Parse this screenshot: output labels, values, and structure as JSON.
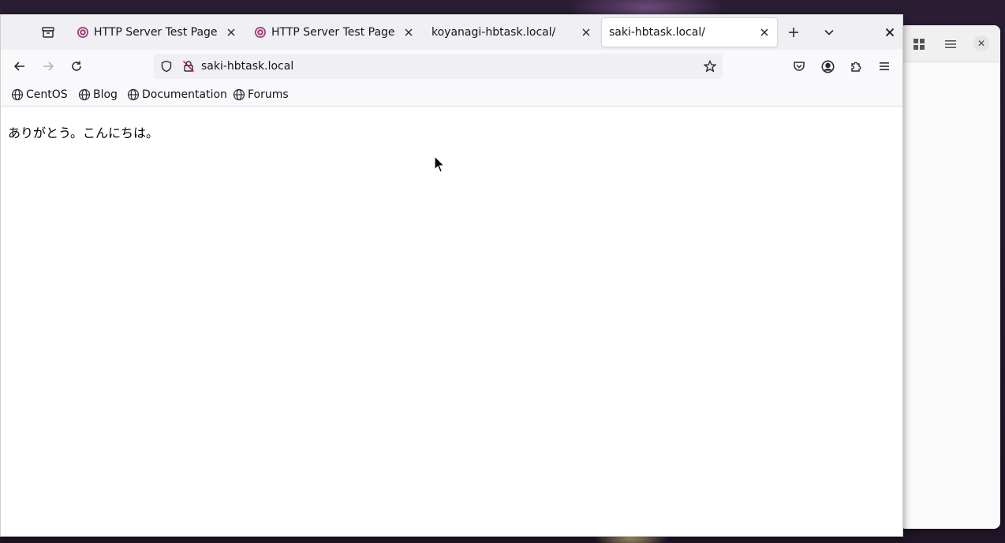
{
  "tabs": [
    {
      "title": "HTTP Server Test Page",
      "has_favicon": true
    },
    {
      "title": "HTTP Server Test Page",
      "has_favicon": true
    },
    {
      "title": "koyanagi-hbtask.local/",
      "has_favicon": false
    },
    {
      "title": "saki-hbtask.local/",
      "has_favicon": false,
      "active": true
    }
  ],
  "urlbar": {
    "value": "saki-hbtask.local"
  },
  "bookmarks": [
    {
      "label": "CentOS"
    },
    {
      "label": "Blog"
    },
    {
      "label": "Documentation"
    },
    {
      "label": "Forums"
    }
  ],
  "page": {
    "body_text": "ありがとう。こんにちは。"
  },
  "icons": {
    "tab_overview": "firefox-view-icon",
    "new_tab": "plus-icon",
    "list_tabs": "chevron-down-icon",
    "close_window": "close-icon",
    "back": "arrow-left-icon",
    "forward": "arrow-right-icon",
    "reload": "reload-icon",
    "tracking": "shield-icon",
    "insecure": "lock-slash-icon",
    "bookmark_star": "star-icon",
    "pocket": "pocket-icon",
    "account": "account-icon",
    "extensions": "puzzle-icon",
    "menu": "hamburger-icon",
    "bookmark_favicon": "globe-icon"
  },
  "colors": {
    "tabbar_bg": "#f0f0f4",
    "navbar_bg": "#f9f9fb",
    "favicon_accent": "#a0447a"
  }
}
